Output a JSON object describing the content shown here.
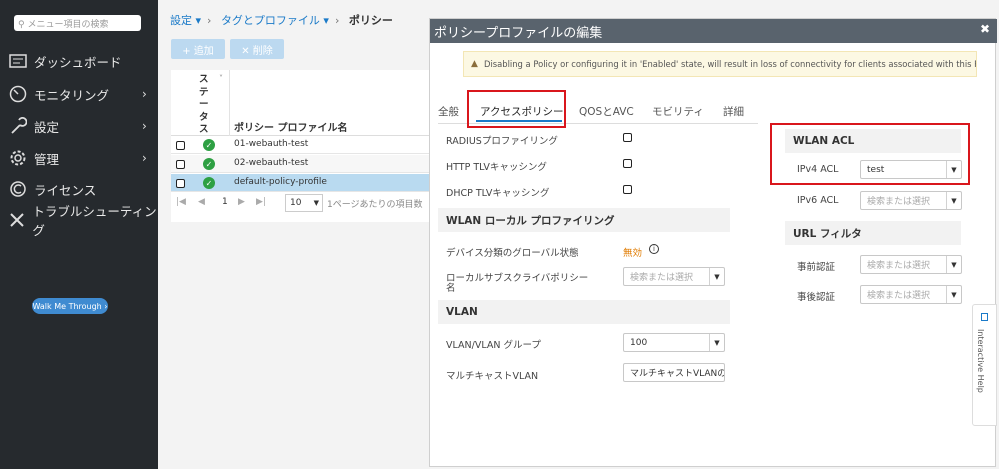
{
  "sidebar": {
    "search_placeholder": "メニュー項目の検索",
    "items": [
      {
        "label": "ダッシュボード",
        "icon": "dashboard-icon"
      },
      {
        "label": "モニタリング",
        "icon": "gauge-icon"
      },
      {
        "label": "設定",
        "icon": "wrench-icon"
      },
      {
        "label": "管理",
        "icon": "gear-icon"
      },
      {
        "label": "ライセンス",
        "icon": "license-icon"
      },
      {
        "label": "トラブルシューティング",
        "icon": "tools-icon"
      }
    ],
    "walkme": "Walk Me Through ›"
  },
  "breadcrumb": {
    "item1": "設定",
    "item2": "タグとプロファイル",
    "current": "ポリシー"
  },
  "toolbar": {
    "add": "+ 追加",
    "delete": "✕ 削除"
  },
  "table": {
    "status_header": "ステータス",
    "name_header": "ポリシー プロファイル名",
    "rows": [
      {
        "name": "01-webauth-test"
      },
      {
        "name": "02-webauth-test"
      },
      {
        "name": "default-policy-profile"
      }
    ],
    "pager": {
      "page": "1",
      "per_page": "10",
      "per_page_label": "1ページあたりの項目数"
    }
  },
  "modal": {
    "title": "ポリシープロファイルの編集",
    "warning": "Disabling a Policy or configuring it in 'Enabled' state, will result in loss of connectivity for clients associated with this Policy profile.",
    "tabs": [
      "全般",
      "アクセスポリシー",
      "QOSとAVC",
      "モビリティ",
      "詳細"
    ],
    "left": {
      "radius": "RADIUSプロファイリング",
      "http_tlv": "HTTP TLVキャッシング",
      "dhcp_tlv": "DHCP TLVキャッシング",
      "wlan_local_header": "WLAN ローカル プロファイリング",
      "device_class_label": "デバイス分類のグローバル状態",
      "device_class_value": "無効",
      "local_sub_label1": "ローカルサブスクライバポリシー",
      "local_sub_label2": "名",
      "local_sub_placeholder": "検索または選択",
      "vlan_header": "VLAN",
      "vlan_group_label": "VLAN/VLAN グループ",
      "vlan_group_value": "100",
      "multicast_label": "マルチキャストVLAN",
      "multicast_value": "マルチキャストVLANの,"
    },
    "right": {
      "wlan_acl_header": "WLAN ACL",
      "ipv4_label": "IPv4 ACL",
      "ipv4_value": "test",
      "ipv6_label": "IPv6 ACL",
      "ipv6_placeholder": "検索または選択",
      "url_header": "URL フィルタ",
      "pre_auth_label": "事前認証",
      "pre_auth_placeholder": "検索または選択",
      "post_auth_label": "事後認証",
      "post_auth_placeholder": "検索または選択"
    }
  },
  "help": {
    "label": "Interactive Help"
  },
  "colors": {
    "sidebar_bg": "#262a2e",
    "accent": "#1a7ac8",
    "highlight": "#d9161c",
    "warning_value": "#e07b00"
  }
}
